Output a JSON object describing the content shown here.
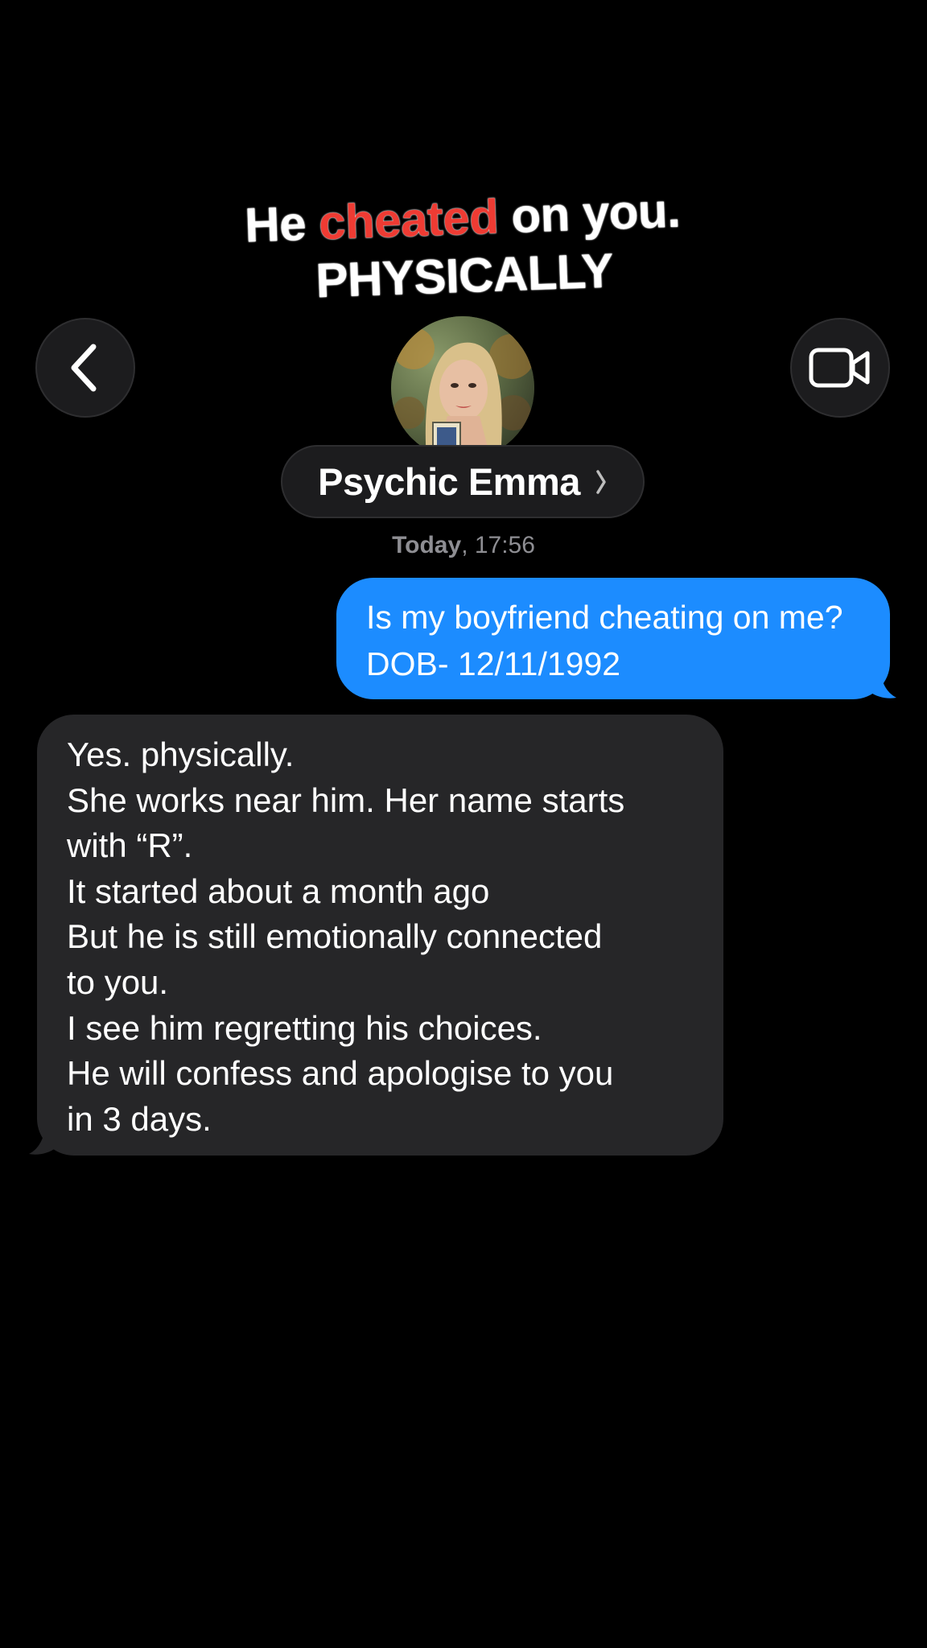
{
  "overlay": {
    "line1_part1": "He ",
    "line1_accent": "cheated",
    "line1_part2": " on you.",
    "line2": "PHYSICALLY",
    "accent_color": "#ee3b33"
  },
  "header": {
    "back_icon": "chevron-left-icon",
    "video_icon": "video-camera-icon",
    "contact_name": "Psychic Emma",
    "contact_chevron_icon": "chevron-right-icon"
  },
  "conversation": {
    "timestamp_day": "Today",
    "timestamp_time": ", 17:56",
    "messages": [
      {
        "direction": "outgoing",
        "bubble_color": "#1c8cff",
        "lines": [
          "Is my boyfriend cheating on me?",
          "DOB- 12/11/1992"
        ]
      },
      {
        "direction": "incoming",
        "bubble_color": "#262628",
        "lines": [
          "Yes. physically.",
          "She works near him. Her name starts",
          "with “R”.",
          "It started about a month ago",
          "But he is still emotionally connected",
          "to you.",
          "I see him regretting his choices.",
          "He will confess and apologise to you",
          "in 3 days."
        ]
      }
    ]
  }
}
